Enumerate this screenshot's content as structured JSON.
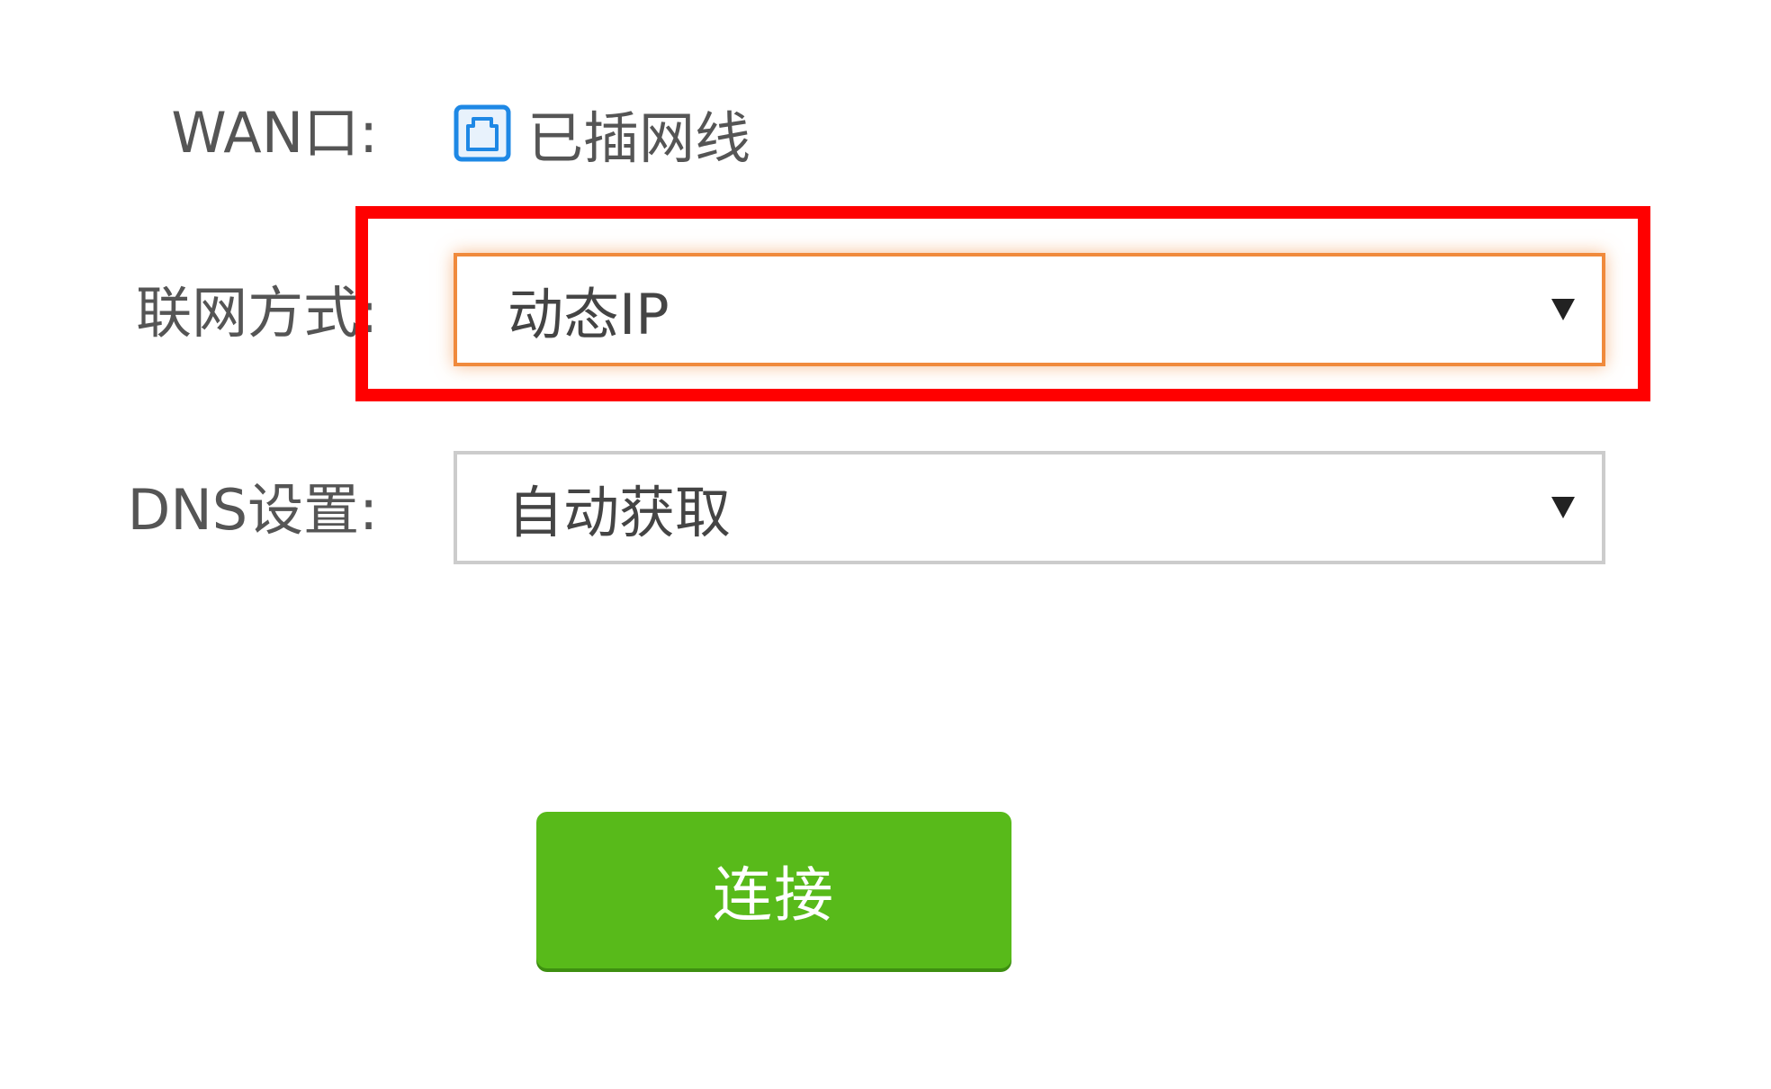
{
  "wan": {
    "label": "WAN口:",
    "status_icon": "ethernet-port-icon",
    "status_text": "已插网线",
    "icon_color": "#1e88e5"
  },
  "connection_type": {
    "label": "联网方式:",
    "selected": "动态IP"
  },
  "dns": {
    "label": "DNS设置:",
    "selected": "自动获取"
  },
  "connect_button": {
    "label": "连接",
    "color": "#58ba1a"
  },
  "colors": {
    "highlight": "#ff0000",
    "focus_border": "#f08a3c"
  }
}
